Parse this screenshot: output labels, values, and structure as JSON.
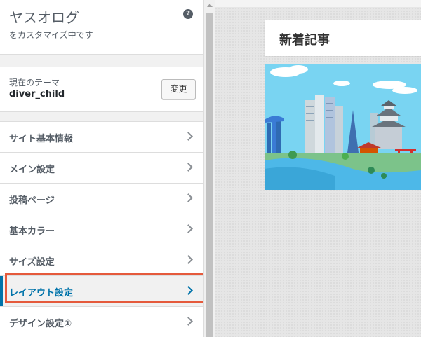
{
  "site": {
    "title": "ヤスオログ",
    "subtitle": "をカスタマイズ中です"
  },
  "theme": {
    "label": "現在のテーマ",
    "name": "diver_child",
    "change_label": "変更"
  },
  "menu": {
    "items": [
      {
        "label": "サイト基本情報"
      },
      {
        "label": "メイン設定"
      },
      {
        "label": "投稿ページ"
      },
      {
        "label": "基本カラー"
      },
      {
        "label": "サイズ設定"
      },
      {
        "label": "レイアウト設定"
      },
      {
        "label": "デザイン設定①"
      }
    ],
    "active_label": "レイアウト設定"
  },
  "preview": {
    "section_title": "新着記事"
  },
  "colors": {
    "accent": "#0073aa",
    "highlight": "#e55a3c",
    "sky": "#79d4f2",
    "water": "#4db8e8"
  }
}
